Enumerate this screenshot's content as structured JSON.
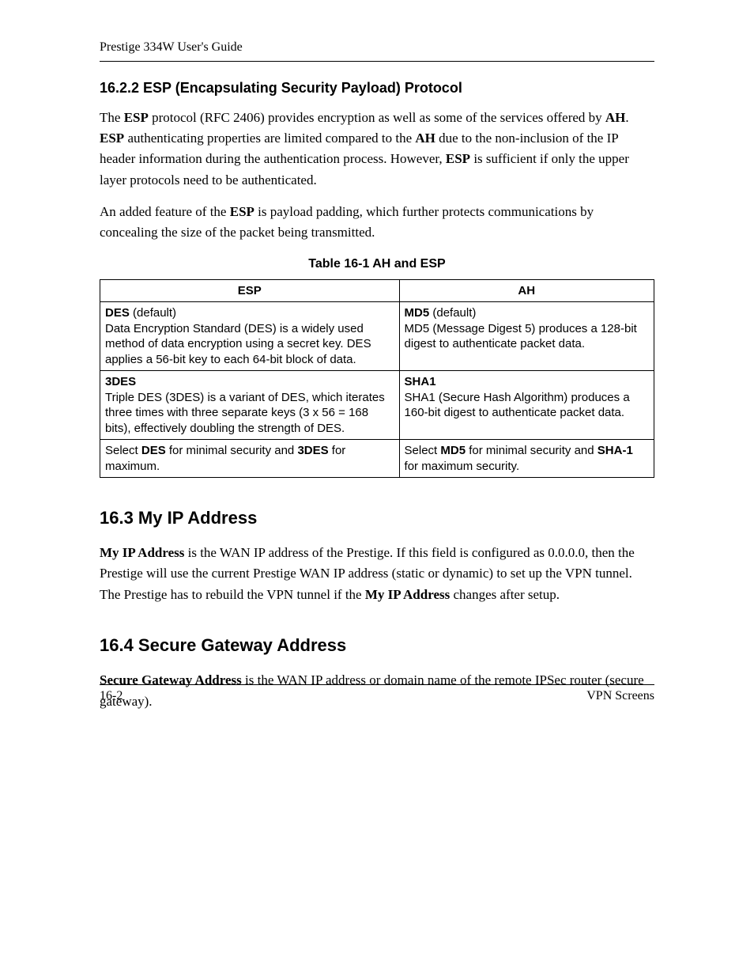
{
  "header": {
    "title": "Prestige 334W User's Guide"
  },
  "sections": {
    "s1_heading": "16.2.2 ESP (Encapsulating Security Payload) Protocol",
    "s2_heading": "16.3  My IP Address",
    "s3_heading": "16.4  Secure Gateway Address"
  },
  "para": {
    "p1": {
      "t1": "The ",
      "b1": "ESP",
      "t2": " protocol (RFC 2406) provides encryption as well as some of the services offered by ",
      "b2": "AH",
      "t3": ". ",
      "b3": "ESP",
      "t4": " authenticating properties are limited compared to the ",
      "b4": "AH",
      "t5": " due to the non-inclusion of the IP header information during the authentication process. However, ",
      "b5": "ESP",
      "t6": " is sufficient if only the upper layer protocols need to be authenticated."
    },
    "p2": {
      "t1": "An added feature of the ",
      "b1": "ESP",
      "t2": " is payload padding, which further protects communications by concealing the size of the packet being transmitted."
    },
    "p3": {
      "b1": "My IP Address",
      "t1": " is the WAN IP address of the Prestige. If this field is configured as 0.0.0.0, then the Prestige will use the current Prestige WAN IP address (static or dynamic) to set up the VPN tunnel. The Prestige has to rebuild the VPN tunnel if the ",
      "b2": "My IP Address",
      "t2": " changes after setup."
    },
    "p4": {
      "b1": "Secure Gateway Address",
      "t1": " is the WAN IP address or domain name of the remote IPSec router (secure gateway)."
    }
  },
  "table": {
    "caption": "Table 16-1 AH and ESP",
    "head_esp": "ESP",
    "head_ah": "AH",
    "r1c1_b": "DES",
    "r1c1_def": " (default)",
    "r1c1_rest": "Data Encryption Standard (DES) is a widely used method of data encryption using a secret key. DES applies a 56-bit key to each 64-bit block of data.",
    "r1c2_b": "MD5",
    "r1c2_def": " (default)",
    "r1c2_rest": "MD5 (Message Digest 5) produces a 128-bit digest to authenticate packet data.",
    "r2c1_b": "3DES",
    "r2c1_rest": "Triple DES (3DES) is a variant of DES, which iterates three times with three separate keys (3 x 56 = 168 bits), effectively doubling the strength of DES.",
    "r2c2_b": "SHA1",
    "r2c2_rest": "SHA1 (Secure Hash Algorithm) produces a 160-bit digest to authenticate packet data.",
    "r3c1_a": "Select ",
    "r3c1_b1": "DES",
    "r3c1_mid": " for minimal security and ",
    "r3c1_b2": "3DES",
    "r3c1_end": " for maximum.",
    "r3c2_a": "Select ",
    "r3c2_b1": "MD5",
    "r3c2_mid": " for minimal security and ",
    "r3c2_b2": "SHA-1",
    "r3c2_end": " for maximum security."
  },
  "footer": {
    "left": "16-2",
    "right": "VPN Screens"
  }
}
